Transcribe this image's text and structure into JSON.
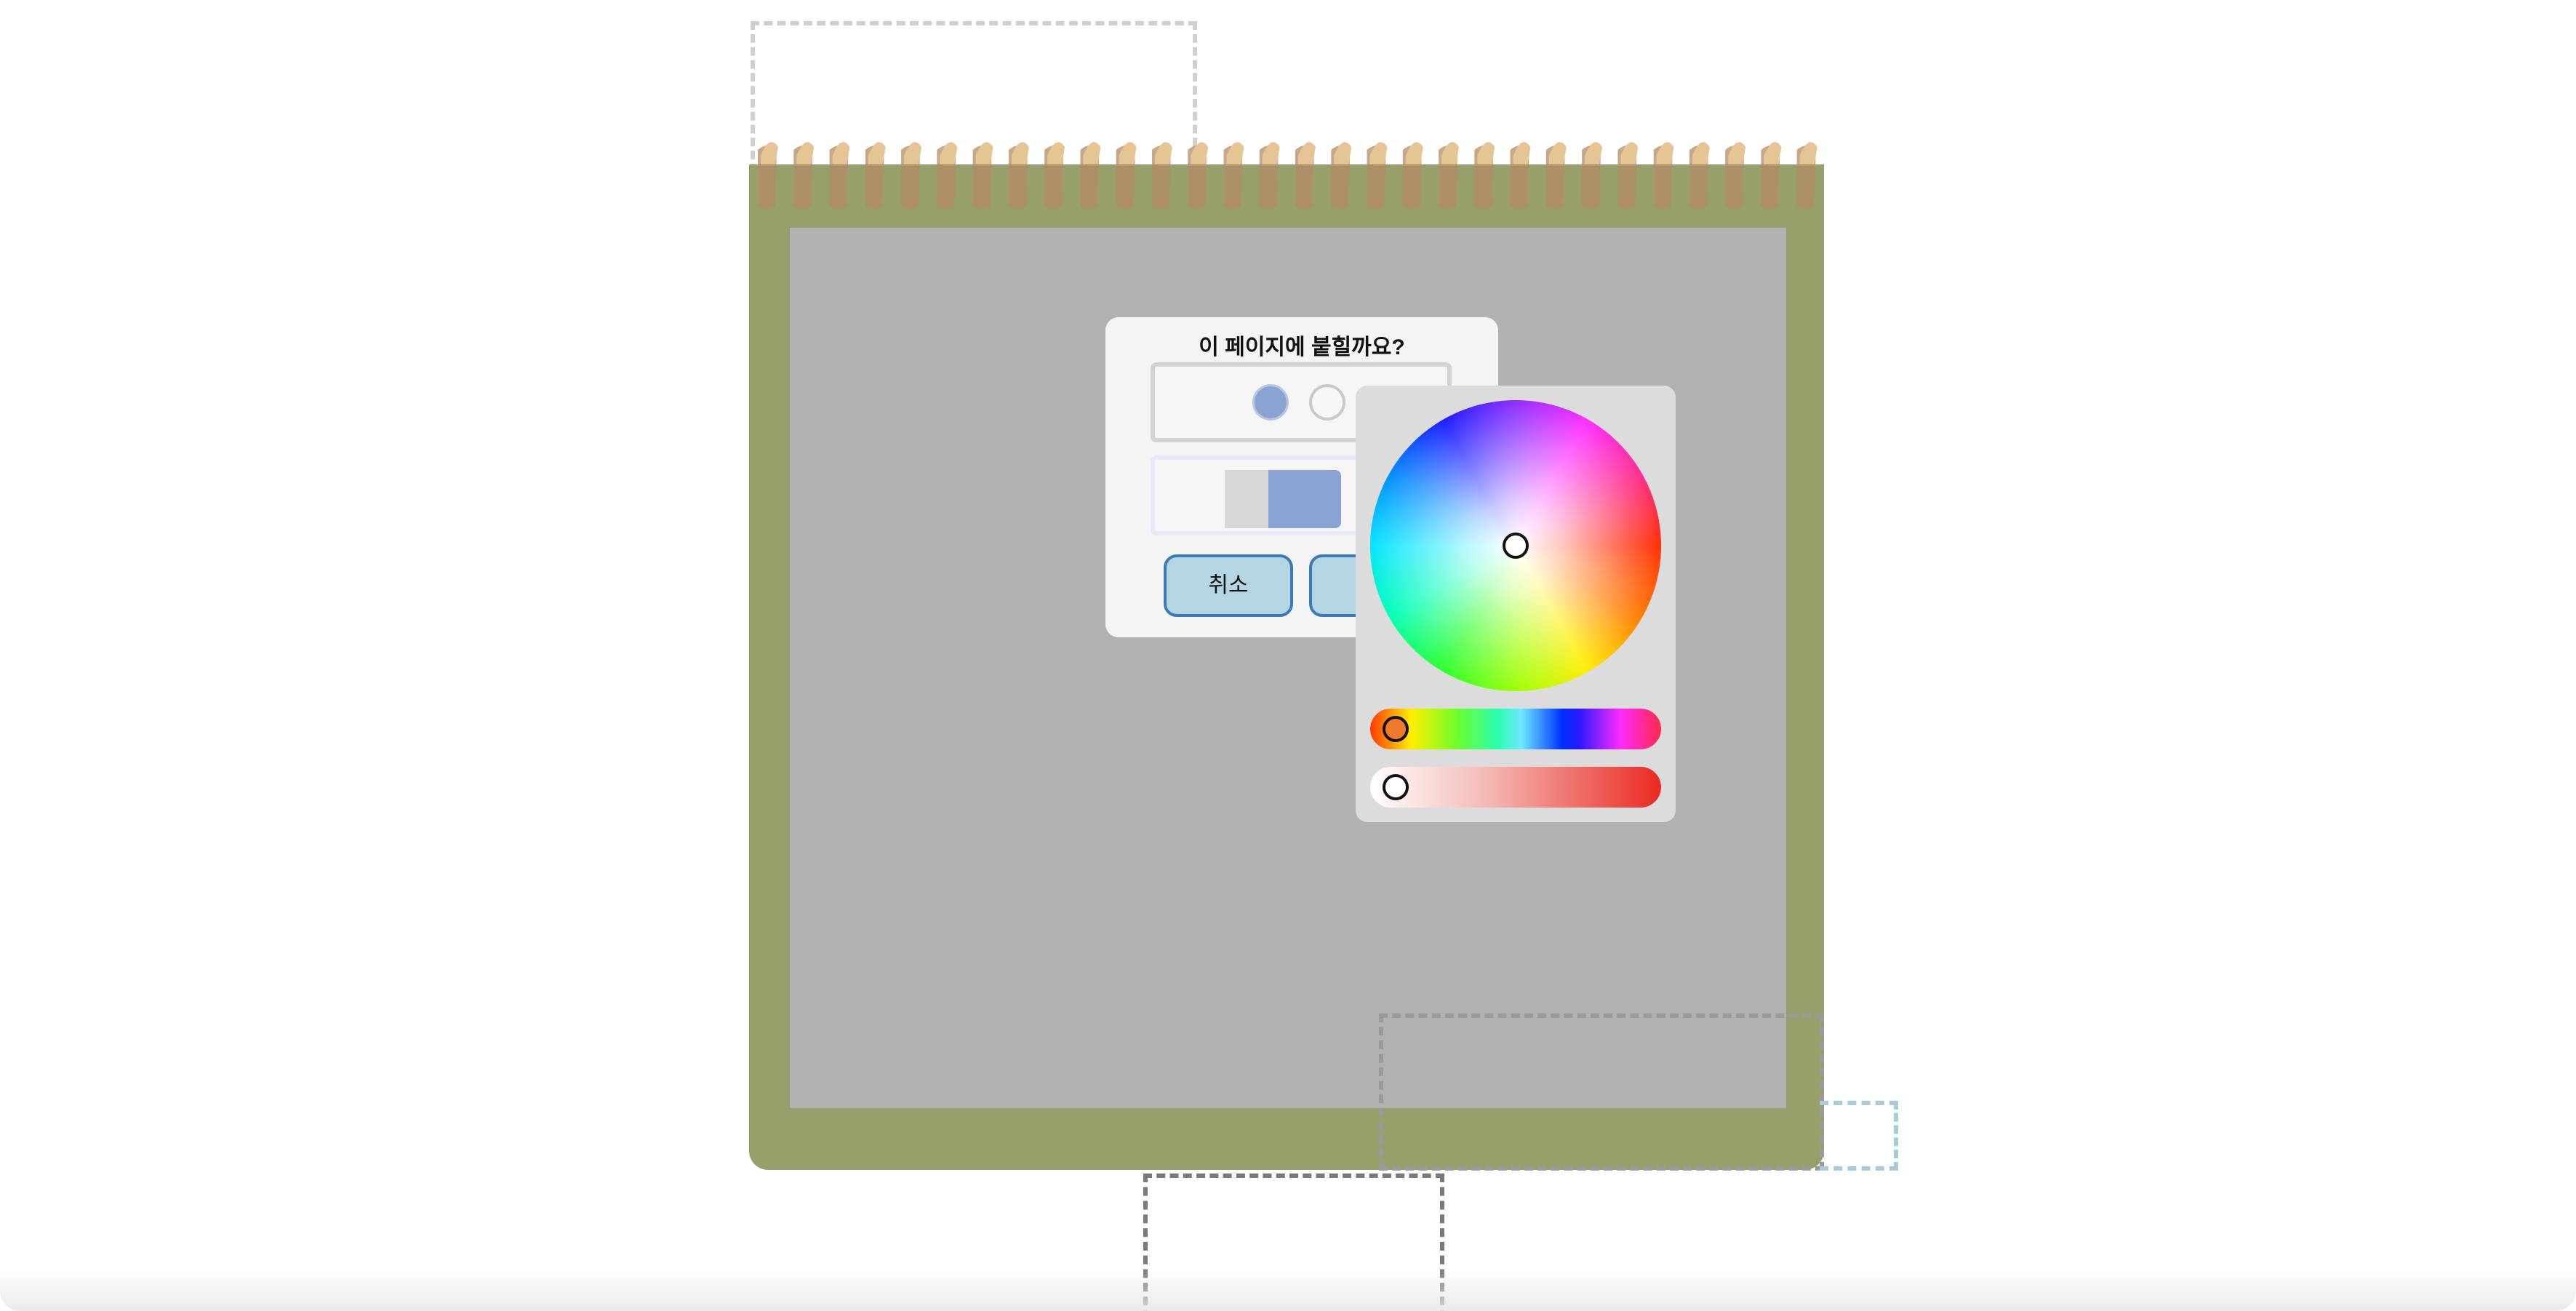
{
  "dialog": {
    "title": "이 페이지에 붙힐까요?",
    "cancel_label": "취소",
    "confirm_label": ""
  },
  "swatches": [
    {
      "color": "#8aa3d3",
      "selected": true
    },
    {
      "color": "#f6f6f6",
      "selected": false
    }
  ],
  "preview": {
    "old_color": "#d8d8d8",
    "new_color": "#8aa3d3"
  },
  "color_picker": {
    "wheel": "hue-saturation-wheel",
    "hue_slider_value": 0.02,
    "alpha_slider_value": 0.02,
    "thumb_color": "#f07a2a"
  },
  "board": {
    "color": "#979f6a",
    "sheet_color": "#b1b1b1",
    "spiral_color": "#e6c594"
  }
}
